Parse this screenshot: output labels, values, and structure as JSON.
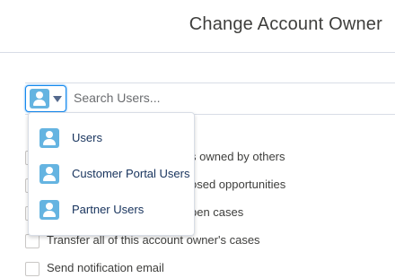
{
  "header": {
    "title": "Change Account Owner"
  },
  "search": {
    "placeholder": "Search Users...",
    "entity_icon": "user-icon",
    "entity_caret_icon": "chevron-down-icon"
  },
  "options": [
    {
      "label": "Transfer open opportunities not owned by others",
      "visible_text": "s owned by others",
      "checked": false
    },
    {
      "label": "Transfer closed opportunities",
      "visible_text": "osed opportunities",
      "checked": false
    },
    {
      "label": "Transfer open cases",
      "visible_text": "pen cases",
      "checked": false
    },
    {
      "label": "Transfer all of this account owner's cases",
      "visible_text": "Transfer all of this account owner's cases",
      "checked": false
    },
    {
      "label": "Send notification email",
      "visible_text": "Send notification email",
      "checked": false
    }
  ],
  "dropdown": {
    "items": [
      {
        "label": "Users",
        "icon": "user-icon"
      },
      {
        "label": "Customer Portal Users",
        "icon": "user-icon"
      },
      {
        "label": "Partner Users",
        "icon": "user-icon"
      }
    ]
  },
  "colors": {
    "accent": "#1589ee",
    "user_icon": "#65b4e1",
    "text": "#16325c"
  }
}
